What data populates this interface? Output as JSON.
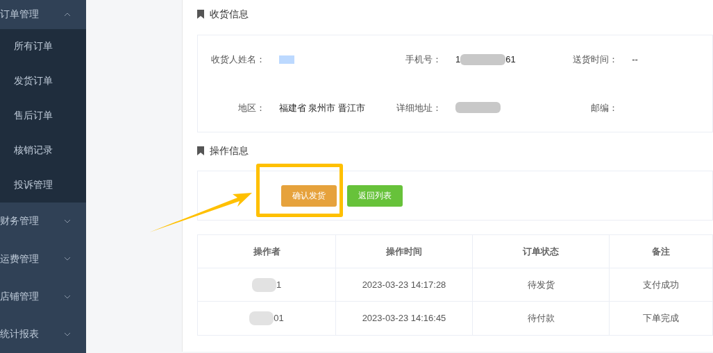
{
  "sidebar": {
    "items": [
      {
        "label": "订单管理",
        "expanded": true,
        "children": [
          {
            "label": "所有订单"
          },
          {
            "label": "发货订单"
          },
          {
            "label": "售后订单"
          },
          {
            "label": "核销记录"
          },
          {
            "label": "投诉管理"
          }
        ]
      },
      {
        "label": "财务管理",
        "expanded": false
      },
      {
        "label": "运费管理",
        "expanded": false
      },
      {
        "label": "店铺管理",
        "expanded": false
      },
      {
        "label": "统计报表",
        "expanded": false
      }
    ]
  },
  "receiver_section": {
    "title": "收货信息",
    "fields": [
      {
        "label": "收货人姓名：",
        "kind": "redacted_name"
      },
      {
        "label": "手机号：",
        "value": "1",
        "value_end": "61",
        "kind": "redacted"
      },
      {
        "label": "送货时间：",
        "value": "--",
        "kind": "text"
      },
      {
        "label": "地区：",
        "value": "福建省 泉州市 晋江市",
        "kind": "text"
      },
      {
        "label": "详细地址：",
        "kind": "redacted"
      },
      {
        "label": "邮编：",
        "kind": "text"
      }
    ]
  },
  "operation_section": {
    "title": "操作信息",
    "annotation": {
      "kind": "frame_with_arrow"
    },
    "buttons": [
      {
        "label": "确认发货",
        "kind": "primary"
      },
      {
        "label": "返回列表",
        "kind": "success"
      }
    ],
    "table": {
      "columns": [
        "操作者",
        "操作时间",
        "订单状态",
        "备注"
      ],
      "rows": [
        {
          "operator_visible": "1",
          "time": "2023-03-23 14:17:28",
          "status": "待发货",
          "note": "支付成功"
        },
        {
          "operator_visible": "01",
          "time": "2023-03-23 14:16:45",
          "status": "待付款",
          "note": "下单完成"
        }
      ]
    }
  }
}
